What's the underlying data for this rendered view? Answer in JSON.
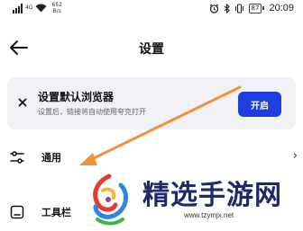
{
  "status_bar": {
    "signal_label": "4G",
    "net_speed_value": "652",
    "net_speed_unit": "B/s",
    "battery": "87",
    "time": "20:09"
  },
  "header": {
    "title": "设置",
    "back_icon": "arrow-left-icon"
  },
  "banner": {
    "title": "设置默认浏览器",
    "subtitle": "设置后，链接将自动使用夸克打开",
    "button_label": "开启",
    "button_color": "#1f3ee0",
    "close_icon": "close-icon"
  },
  "list": {
    "items": [
      {
        "label": "通用",
        "icon": "sliders-icon"
      },
      {
        "label": "工具栏",
        "icon": "toolbar-icon"
      }
    ]
  },
  "overlay": {
    "arrow_color": "#f3913a"
  },
  "watermark": {
    "name": "精选手游网",
    "url": "www.tzymjx.net"
  }
}
